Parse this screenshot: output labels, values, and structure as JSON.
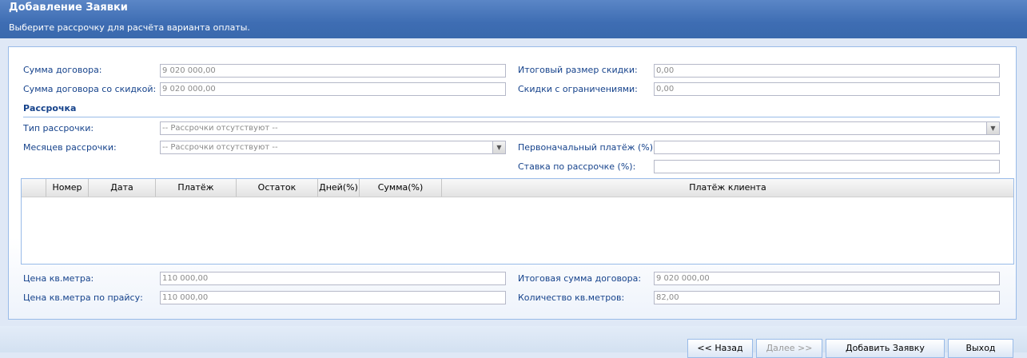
{
  "header": {
    "title": "Добавление Заявки",
    "subtitle": "Выберите рассрочку для расчёта варианта оплаты."
  },
  "fields": {
    "contract_sum": {
      "label": "Сумма договора:",
      "value": "9 020 000,00"
    },
    "contract_sum_discount": {
      "label": "Сумма договора со скидкой:",
      "value": "9 020 000,00"
    },
    "total_discount": {
      "label": "Итоговый размер скидки:",
      "value": "0,00"
    },
    "limited_discounts": {
      "label": "Скидки с ограничениями:",
      "value": "0,00"
    }
  },
  "installment": {
    "section_title": "Рассрочка",
    "type": {
      "label": "Тип рассрочки:",
      "value": "-- Рассрочки отсутствуют --"
    },
    "months": {
      "label": "Месяцев рассрочки:",
      "value": "-- Рассрочки отсутствуют --"
    },
    "initial_payment": {
      "label": "Первоначальный платёж (%):",
      "value": ""
    },
    "rate": {
      "label": "Ставка по рассрочке (%):",
      "value": ""
    }
  },
  "table": {
    "columns": [
      "Номер",
      "Дата",
      "Платёж",
      "Остаток",
      "Дней(%)",
      "Сумма(%)",
      "Платёж клиента"
    ],
    "rows": []
  },
  "bottom_fields": {
    "price_sqm": {
      "label": "Цена кв.метра:",
      "value": "110 000,00"
    },
    "price_sqm_list": {
      "label": "Цена кв.метра по прайсу:",
      "value": "110 000,00"
    },
    "total_contract_sum": {
      "label": "Итоговая сумма договора:",
      "value": "9 020 000,00"
    },
    "sqm_count": {
      "label": "Количество кв.метров:",
      "value": "82,00"
    }
  },
  "buttons": {
    "back": "<< Назад",
    "next": "Далее >>",
    "add_request": "Добавить Заявку",
    "exit": "Выход"
  },
  "colors": {
    "header_bg": "#3e6db3",
    "label_text": "#15428b",
    "panel_border": "#99bbe8"
  }
}
